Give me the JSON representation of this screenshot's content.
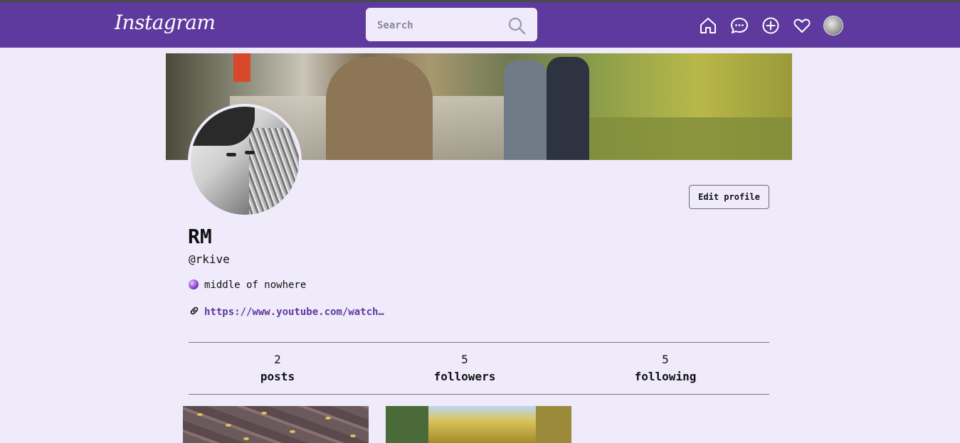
{
  "app": {
    "logo": "Instagram"
  },
  "search": {
    "placeholder": "Search"
  },
  "nav": {
    "icons": [
      "home-icon",
      "messages-icon",
      "create-icon",
      "notifications-icon",
      "profile-avatar"
    ]
  },
  "profile": {
    "name": "RM",
    "handle": "@rkive",
    "bio": "middle of nowhere",
    "link": "https://www.youtube.com/watch…",
    "edit_label": "Edit profile"
  },
  "stats": [
    {
      "value": "2",
      "label": "posts"
    },
    {
      "value": "5",
      "label": "followers"
    },
    {
      "value": "5",
      "label": "following"
    }
  ],
  "colors": {
    "nav": "#5e3a9e",
    "background": "#efebfb",
    "link": "#5e3a9e"
  }
}
